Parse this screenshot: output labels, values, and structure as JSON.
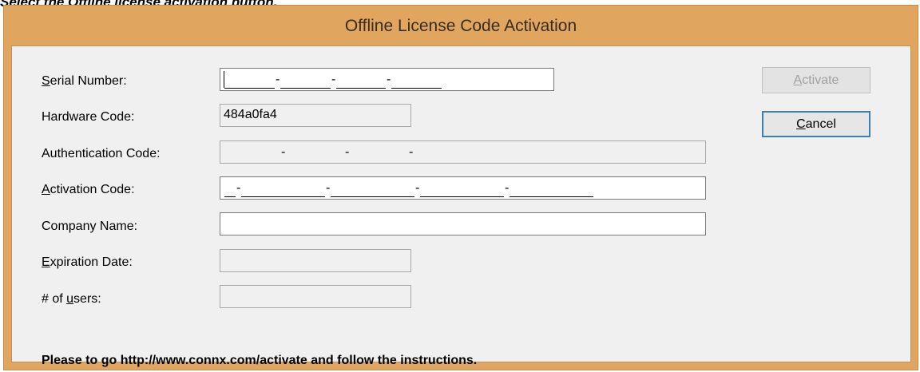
{
  "caption": "Select the Offline license activation button.",
  "dialog": {
    "title": "Offline License Code Activation",
    "fields": {
      "serial_number": {
        "label": "Serial Number:",
        "value": ""
      },
      "hardware_code": {
        "label": "Hardware Code:",
        "value": "484a0fa4"
      },
      "authentication_code": {
        "label": "Authentication Code:",
        "value": ""
      },
      "activation_code": {
        "label": "Activation Code:",
        "value": ""
      },
      "company_name": {
        "label": "Company Name:",
        "value": ""
      },
      "expiration_date": {
        "label": "Expiration Date:",
        "value": ""
      },
      "num_users": {
        "label": "# of users:",
        "value": ""
      }
    },
    "buttons": {
      "activate": "Activate",
      "cancel": "Cancel"
    },
    "instruction": "Please to go http://www.connx.com/activate and follow the instructions."
  }
}
